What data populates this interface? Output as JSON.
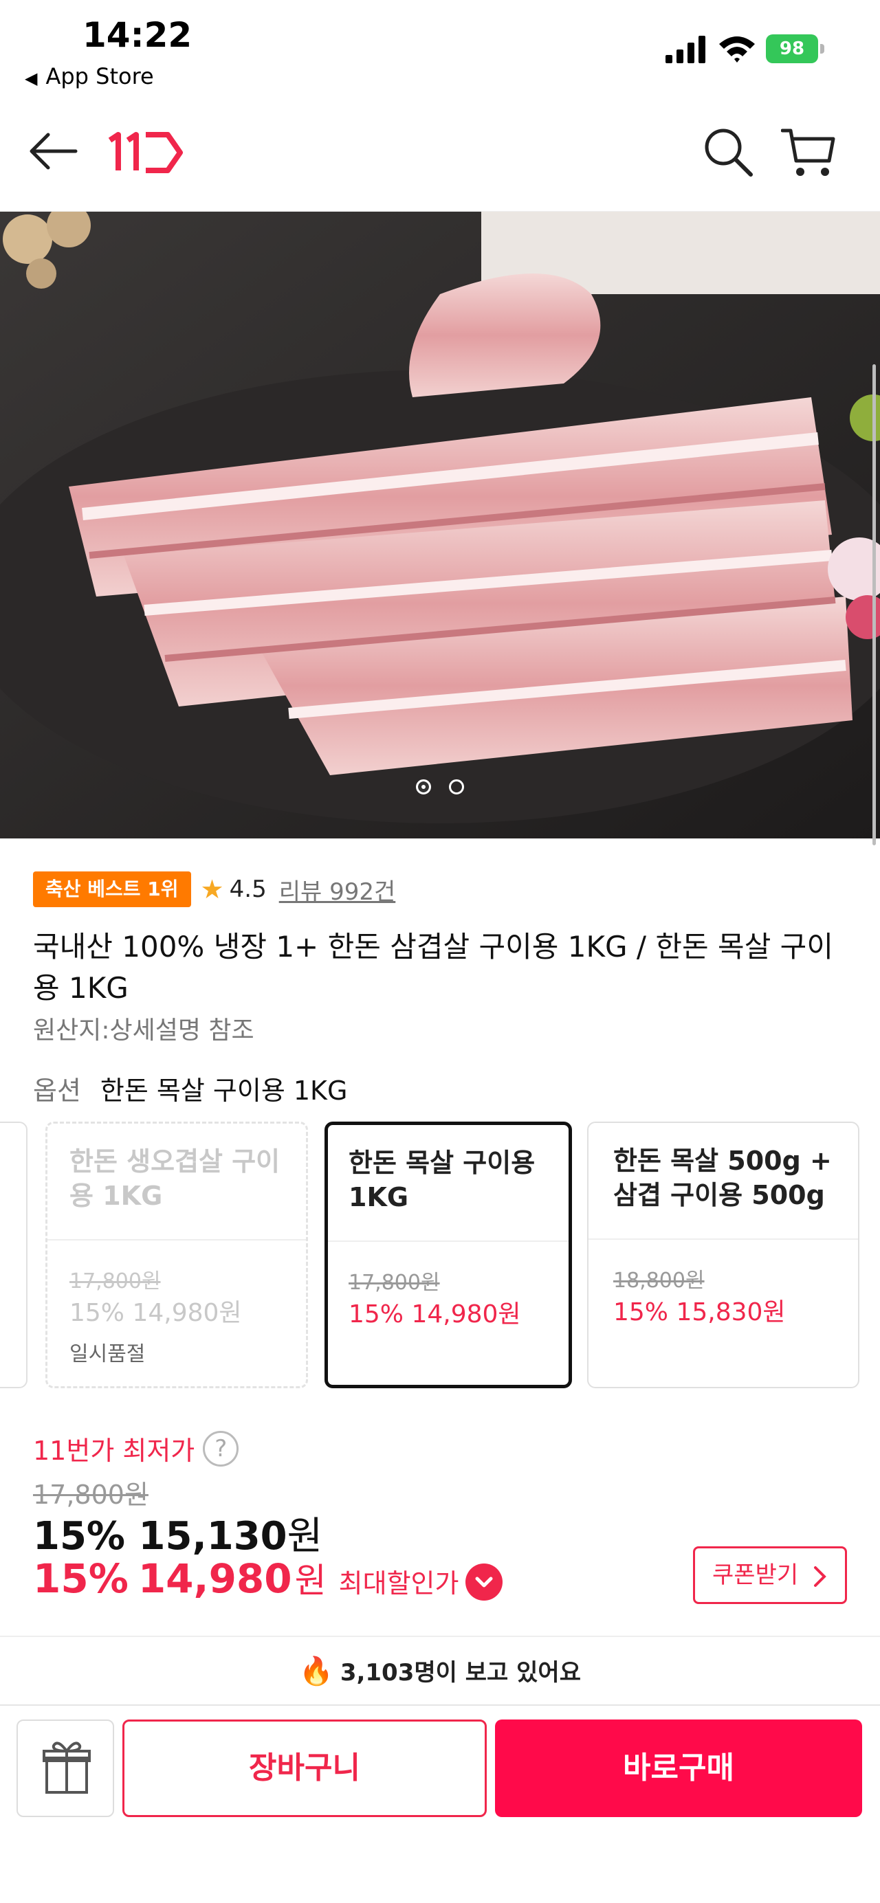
{
  "status_bar": {
    "time": "14:22",
    "back_label": "App Store",
    "battery": "98"
  },
  "header": {
    "logo_text": "11",
    "brand_color": "#f0264b"
  },
  "gallery": {
    "page_count": 2,
    "active_index": 0
  },
  "product": {
    "best_badge": "축산 베스트 1위",
    "rating": "4.5",
    "review_link": "리뷰 992건",
    "title": "국내산 100% 냉장 1+ 한돈 삼겹살 구이용 1KG / 한돈 목살 구이용 1KG",
    "origin": "원산지:상세설명 참조"
  },
  "options": {
    "label": "옵션",
    "selected_value": "한돈 목살 구이용 1KG",
    "cards": [
      {
        "name": "한돈 생오겹살 구이용 1KG",
        "original": "17,800원",
        "sale": "15% 14,980원",
        "status": "일시품절",
        "state": "soldout"
      },
      {
        "name": "한돈 목살 구이용 1KG",
        "original": "17,800원",
        "sale": "15% 14,980원",
        "status": "",
        "state": "selected"
      },
      {
        "name": "한돈 목살 500g + 삼겹 구이용 500g",
        "original": "18,800원",
        "sale": "15% 15,830원",
        "status": "",
        "state": "normal"
      }
    ]
  },
  "pricing": {
    "lowest_label": "11번가 최저가",
    "help_glyph": "?",
    "strike_price": "17,800원",
    "discount_pct_1": "15%",
    "price_1": "15,130",
    "won": "원",
    "discount_pct_2": "15%",
    "price_2": "14,980",
    "max_discount_label": "최대할인가",
    "coupon_button": "쿠폰받기"
  },
  "viewers": {
    "text": "3,103명이 보고 있어요"
  },
  "actions": {
    "cart": "장바구니",
    "buy": "바로구매"
  }
}
